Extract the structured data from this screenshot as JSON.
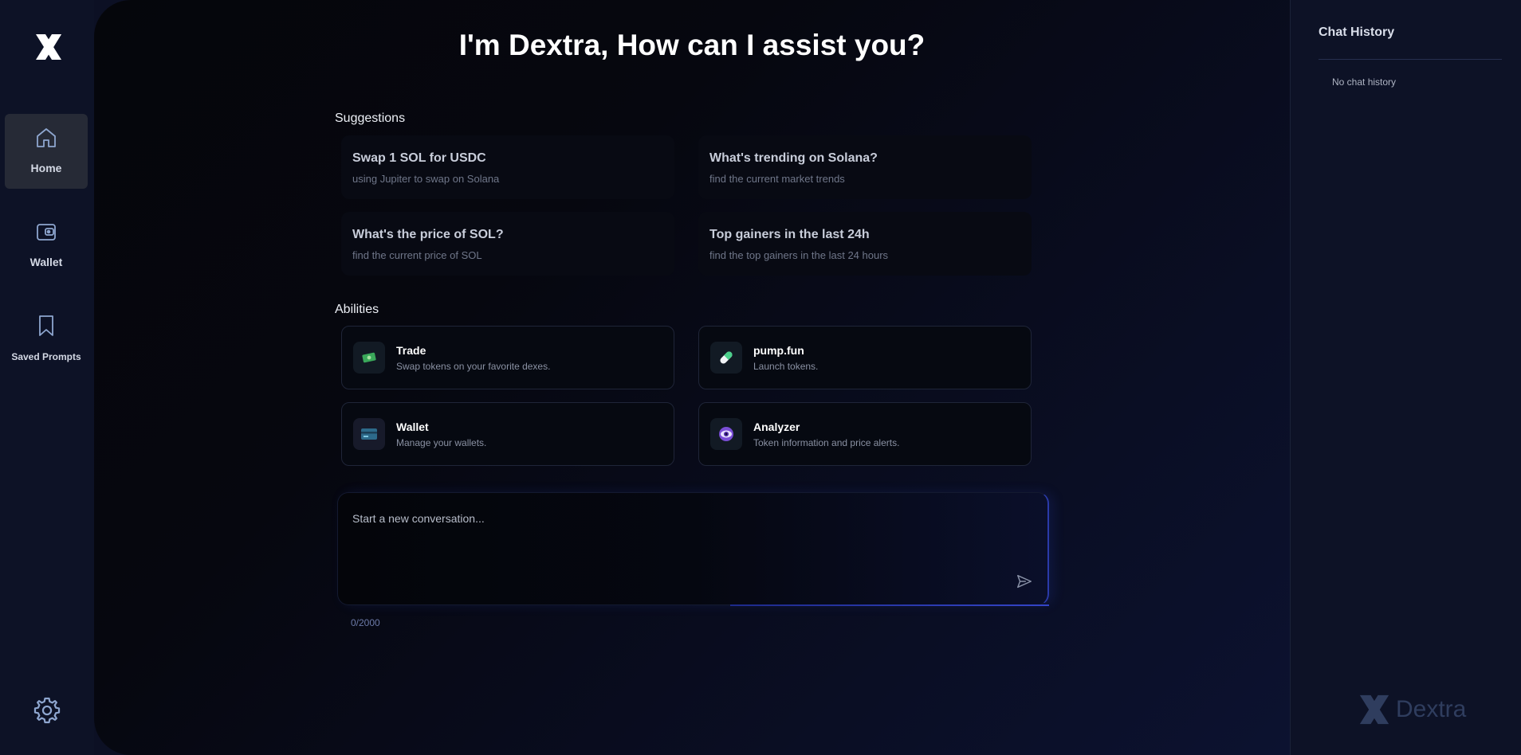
{
  "nav": {
    "items": [
      {
        "label": "Home",
        "icon": "home-icon",
        "active": true
      },
      {
        "label": "Wallet",
        "icon": "wallet-icon",
        "active": false
      },
      {
        "label": "Saved Prompts",
        "icon": "bookmark-icon",
        "active": false
      }
    ],
    "settings_icon": "gear-icon"
  },
  "main": {
    "title": "I'm Dextra, How can I assist you?",
    "suggestions_label": "Suggestions",
    "suggestions": [
      {
        "title": "Swap 1 SOL for USDC",
        "subtitle": "using Jupiter to swap on Solana"
      },
      {
        "title": "What's trending on Solana?",
        "subtitle": "find the current market trends"
      },
      {
        "title": "What's the price of SOL?",
        "subtitle": "find the current price of SOL"
      },
      {
        "title": "Top gainers in the last 24h",
        "subtitle": "find the top gainers in the last 24 hours"
      }
    ],
    "abilities_label": "Abilities",
    "abilities": [
      {
        "title": "Trade",
        "subtitle": "Swap tokens on your favorite dexes.",
        "icon": "money-icon"
      },
      {
        "title": "pump.fun",
        "subtitle": "Launch tokens.",
        "icon": "pill-icon"
      },
      {
        "title": "Wallet",
        "subtitle": "Manage your wallets.",
        "icon": "card-icon"
      },
      {
        "title": "Analyzer",
        "subtitle": "Token information and price alerts.",
        "icon": "eye-icon"
      }
    ],
    "chat": {
      "placeholder": "Start a new conversation...",
      "value": "",
      "counter": "0/2000"
    }
  },
  "history": {
    "title": "Chat History",
    "empty_text": "No chat history",
    "watermark": "Dextra"
  },
  "colors": {
    "accent": "#3445c8",
    "rail_bg": "#0d1226",
    "active_nav_bg": "#262a36"
  }
}
